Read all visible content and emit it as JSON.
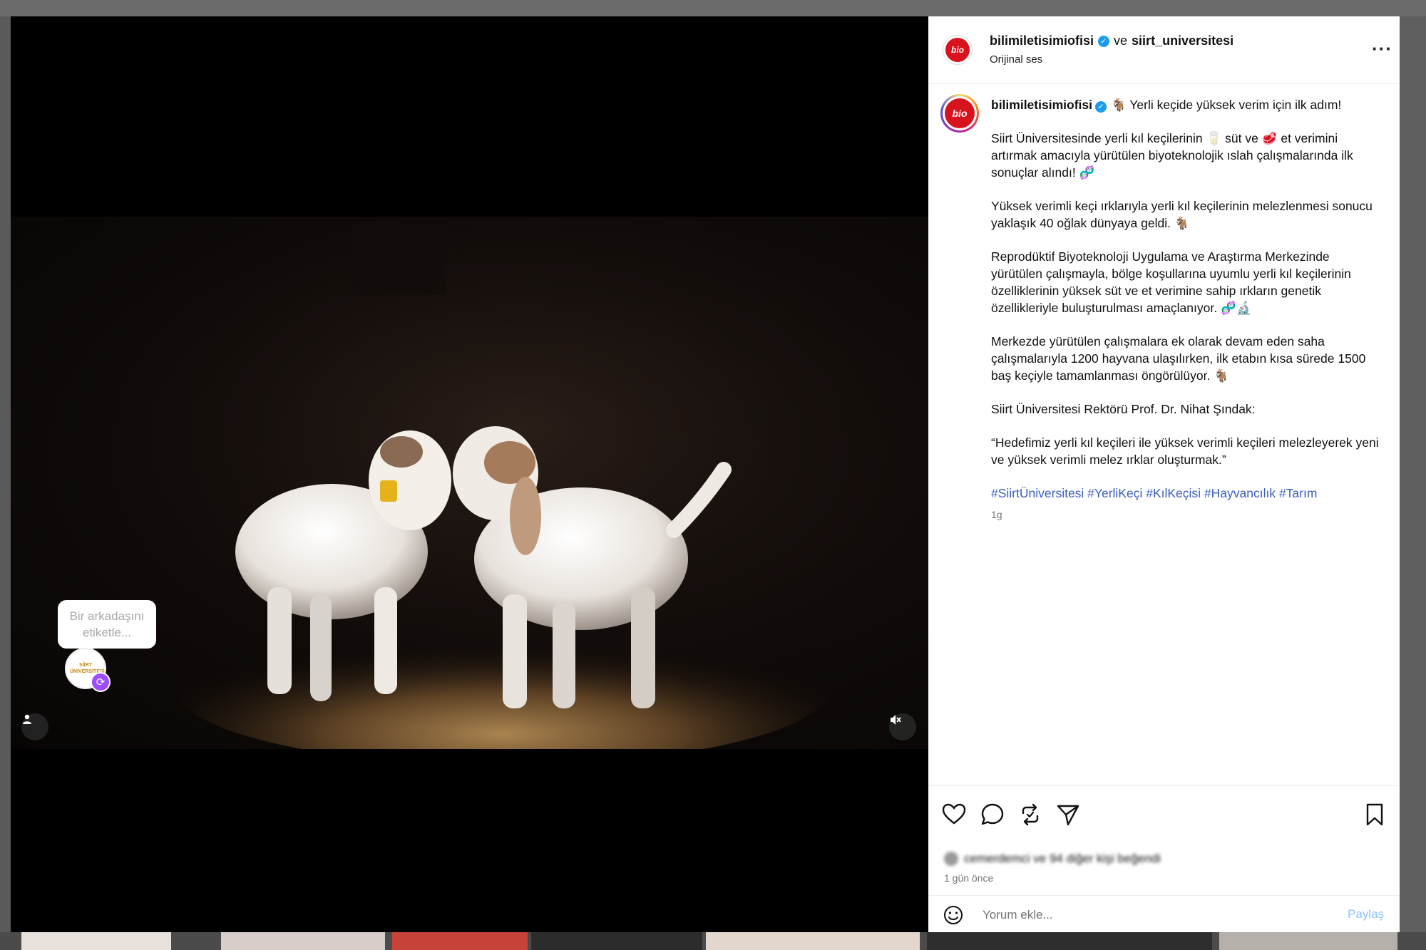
{
  "header": {
    "account": "bilimiletisimiofisi",
    "connector": "ve",
    "collaborator": "siirt_universitesi",
    "audio": "Orijinal ses",
    "logo_text": "bio"
  },
  "media": {
    "tag_prompt": "Bir arkadaşını etiketle...",
    "tag_avatar_text": "SİİRT ÜNİVERSİTESİ"
  },
  "caption": {
    "username": "bilimiletisimiofisi",
    "line1": "🐐 Yerli keçide yüksek verim için ilk adım!",
    "p1": "Siirt Üniversitesinde yerli kıl keçilerinin 🥛 süt ve 🥩 et verimini artırmak amacıyla yürütülen biyoteknolojik ıslah çalışmalarında ilk sonuçlar alındı! 🧬",
    "p2": "Yüksek verimli keçi ırklarıyla yerli kıl keçilerinin melezlenmesi sonucu yaklaşık 40 oğlak dünyaya geldi. 🐐",
    "p3": "Reprodüktif Biyoteknoloji Uygulama ve Araştırma Merkezinde yürütülen çalışmayla, bölge koşullarına uyumlu yerli kıl keçilerinin özelliklerinin yüksek süt ve et verimine sahip ırkların genetik özellikleriyle buluşturulması amaçlanıyor. 🧬🔬",
    "p4": "Merkezde yürütülen çalışmalara ek olarak devam eden saha çalışmalarıyla 1200 hayvana ulaşılırken, ilk etabın kısa sürede 1500 baş keçiyle tamamlanması öngörülüyor. 🐐",
    "p5": "Siirt Üniversitesi Rektörü Prof. Dr. Nihat Şındak:",
    "p6": "“Hedefimiz yerli kıl keçileri ile yüksek verimli keçileri melezleyerek yeni ve yüksek verimli melez ırklar oluşturmak.”",
    "hashtags": "#SiirtÜniversitesi #YerliKeçi #KılKeçisi #Hayvancılık #Tarım",
    "time": "1g"
  },
  "footer": {
    "likes_text": "cemerdemci ve 94 diğer kişi beğendi",
    "ago": "1 gün önce",
    "comment_placeholder": "Yorum ekle...",
    "post_label": "Paylaş"
  },
  "colors": {
    "brand_red": "#d7141d",
    "verified_blue": "#1d9bf0",
    "link_blue": "#3b5fbf"
  }
}
